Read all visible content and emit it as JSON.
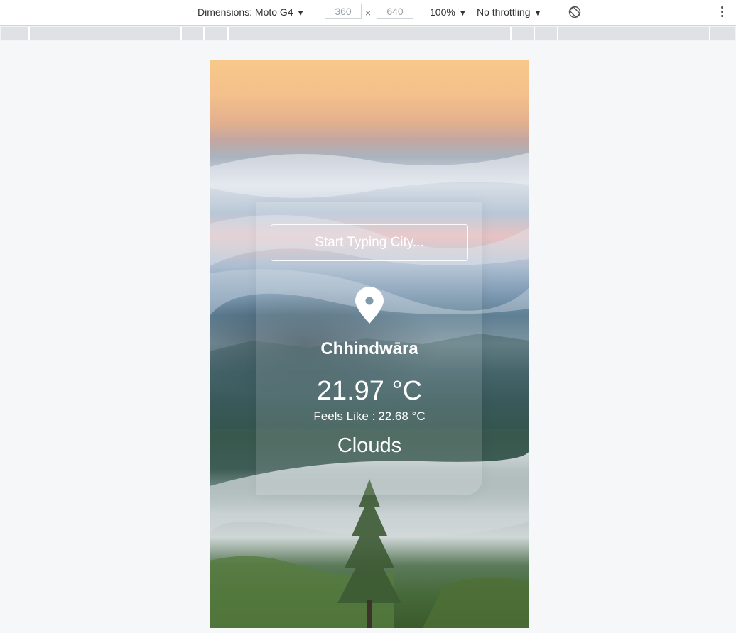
{
  "devtools": {
    "dimensions_label": "Dimensions: Moto G4",
    "width_value": "360",
    "height_value": "640",
    "times": "×",
    "zoom": "100%",
    "throttling": "No throttling",
    "caret": "▼",
    "rotate_icon": "rotate-icon",
    "more_icon": "more-vertical-icon"
  },
  "app": {
    "search": {
      "placeholder": "Start Typing City...",
      "value": ""
    },
    "location_icon": "map-pin-icon",
    "city": "Chhindwāra",
    "temperature": "21.97 °C",
    "feels_like_label": "Feels Like :",
    "feels_like_value": "22.68 °C",
    "condition": "Clouds"
  },
  "colors": {
    "text_on_image": "#ffffff",
    "card_bg": "rgba(255,255,255,0.13)",
    "page_bg": "#f6f7f8"
  }
}
